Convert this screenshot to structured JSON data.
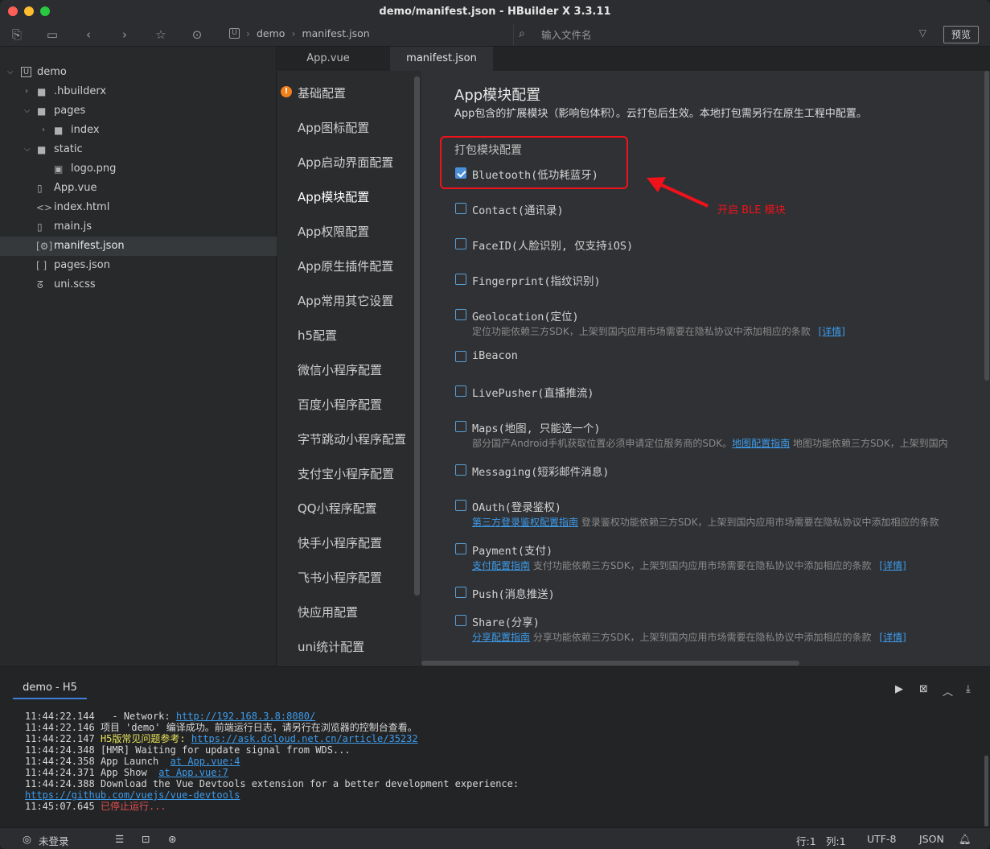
{
  "window": {
    "title": "demo/manifest.json - HBuilder X 3.3.11"
  },
  "toolbar": {
    "breadcrumb": [
      "demo",
      "manifest.json"
    ],
    "search_placeholder": "输入文件名",
    "preview_label": "预览"
  },
  "tree": [
    {
      "label": "demo",
      "type": "project"
    },
    {
      "label": ".hbuilderx",
      "type": "folder"
    },
    {
      "label": "pages",
      "type": "folder"
    },
    {
      "label": "index",
      "type": "folder"
    },
    {
      "label": "static",
      "type": "folder"
    },
    {
      "label": "logo.png",
      "type": "image"
    },
    {
      "label": "App.vue",
      "type": "vue"
    },
    {
      "label": "index.html",
      "type": "html"
    },
    {
      "label": "main.js",
      "type": "js"
    },
    {
      "label": "manifest.json",
      "type": "json",
      "selected": true
    },
    {
      "label": "pages.json",
      "type": "json"
    },
    {
      "label": "uni.scss",
      "type": "scss"
    }
  ],
  "tabs": [
    {
      "label": "App.vue",
      "active": false
    },
    {
      "label": "manifest.json",
      "active": true
    }
  ],
  "nav": [
    "基础配置",
    "App图标配置",
    "App启动界面配置",
    "App模块配置",
    "App权限配置",
    "App原生插件配置",
    "App常用其它设置",
    "h5配置",
    "微信小程序配置",
    "百度小程序配置",
    "字节跳动小程序配置",
    "支付宝小程序配置",
    "QQ小程序配置",
    "快手小程序配置",
    "飞书小程序配置",
    "快应用配置",
    "uni统计配置"
  ],
  "nav_active_index": 3,
  "main": {
    "title": "App模块配置",
    "description": "App包含的扩展模块（影响包体积）。云打包后生效。本地打包需另行在原生工程中配置。",
    "group_label": "打包模块配置",
    "annotation": "开启 BLE 模块",
    "modules": [
      {
        "name": "Bluetooth(低功耗蓝牙)",
        "checked": true
      },
      {
        "name": "Contact(通讯录)",
        "checked": false
      },
      {
        "name": "FaceID(人脸识别, 仅支持iOS)",
        "checked": false
      },
      {
        "name": "Fingerprint(指纹识别)",
        "checked": false
      },
      {
        "name": "Geolocation(定位)",
        "checked": false,
        "desc": "定位功能依赖三方SDK，上架到国内应用市场需要在隐私协议中添加相应的条款",
        "desc_link_after": "[详情]"
      },
      {
        "name": "iBeacon",
        "checked": false
      },
      {
        "name": "LivePusher(直播推流)",
        "checked": false
      },
      {
        "name": "Maps(地图, 只能选一个)",
        "checked": false,
        "desc": "部分国产Android手机获取位置必须申请定位服务商的SDK。",
        "desc_link_mid": "地图配置指南",
        "desc_after": " 地图功能依赖三方SDK，上架到国内"
      },
      {
        "name": "Messaging(短彩邮件消息)",
        "checked": false
      },
      {
        "name": "OAuth(登录鉴权)",
        "checked": false,
        "desc_link_first": "第三方登录鉴权配置指南",
        "desc": " 登录鉴权功能依赖三方SDK，上架到国内应用市场需要在隐私协议中添加相应的条款"
      },
      {
        "name": "Payment(支付)",
        "checked": false,
        "desc_link_first": "支付配置指南",
        "desc": " 支付功能依赖三方SDK，上架到国内应用市场需要在隐私协议中添加相应的条款",
        "desc_link_after": "[详情]"
      },
      {
        "name": "Push(消息推送)",
        "checked": false
      },
      {
        "name": "Share(分享)",
        "checked": false,
        "desc_link_first": "分享配置指南",
        "desc": " 分享功能依赖三方SDK，上架到国内应用市场需要在隐私协议中添加相应的条款",
        "desc_link_after": "[详情]"
      }
    ]
  },
  "console": {
    "tab_label": "demo - H5",
    "lines": [
      {
        "time": "11:44:22.144",
        "text": "  - Network: ",
        "link": "http://192.168.3.8:8080/"
      },
      {
        "time": "11:44:22.146",
        "text": "项目 'demo' 编译成功。前端运行日志，请另行在浏览器的控制台查看。"
      },
      {
        "time": "11:44:22.147",
        "yellow": "H5版常见问题参考: ",
        "link": "https://ask.dcloud.net.cn/article/35232"
      },
      {
        "time": "11:44:24.348",
        "text": "[HMR] Waiting for update signal from WDS..."
      },
      {
        "time": "11:44:24.358",
        "text": "App Launch  ",
        "link": "at App.vue:4"
      },
      {
        "time": "11:44:24.371",
        "text": "App Show  ",
        "link": "at App.vue:7"
      },
      {
        "time": "11:44:24.388",
        "text": "Download the Vue Devtools extension for a better development experience:"
      },
      {
        "time": "",
        "link": "https://github.com/vuejs/vue-devtools"
      },
      {
        "time": "11:45:07.645",
        "red": "已停止运行..."
      }
    ]
  },
  "status": {
    "user": "未登录",
    "line": "行:1",
    "col": "列:1",
    "encoding": "UTF-8",
    "language": "JSON"
  },
  "colors": {
    "accent": "#4a90d9",
    "link": "#3d9bea",
    "annotation": "#f0121b",
    "warning": "#f0801a"
  }
}
